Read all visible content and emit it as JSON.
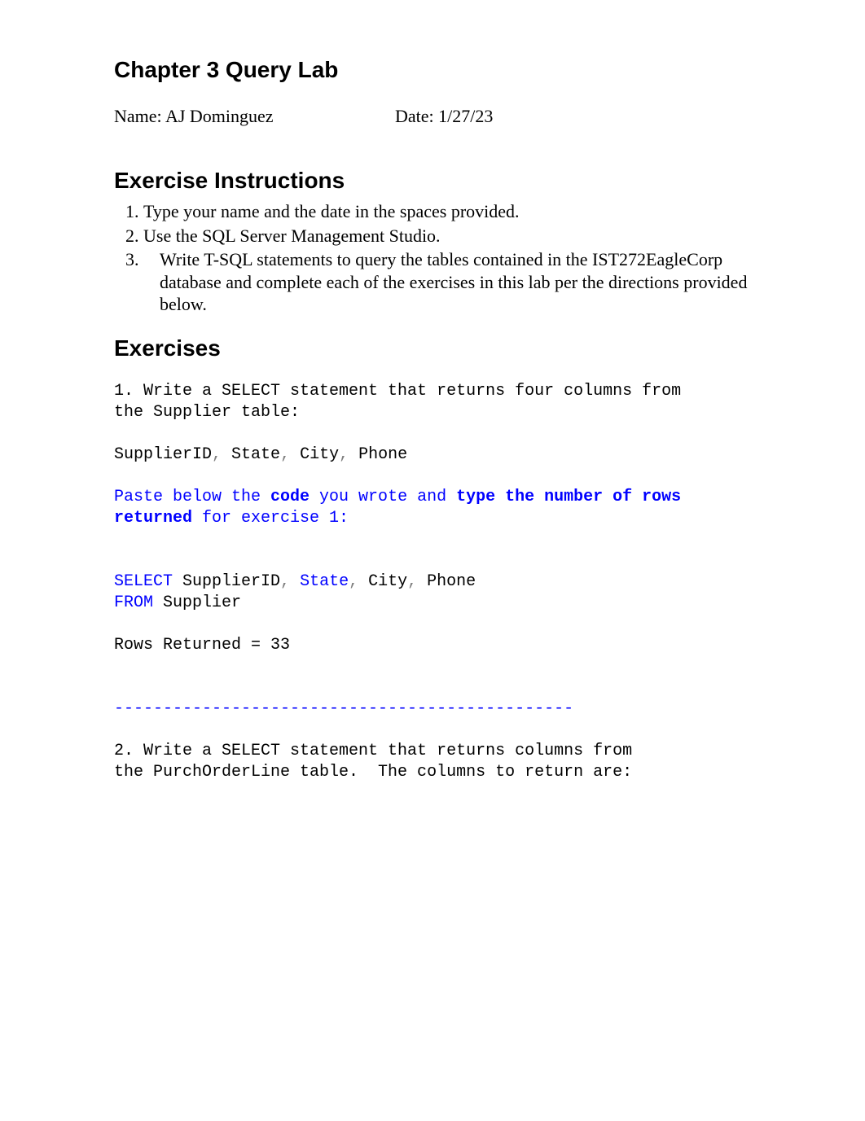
{
  "chapter_title": "Chapter 3 Query Lab",
  "name_label": "Name: ",
  "name_value": "AJ Dominguez",
  "date_label": "Date: ",
  "date_value": "1/27/23",
  "instructions_heading": "Exercise Instructions",
  "instructions": [
    "Type your name and the date in the spaces provided.",
    "Use the SQL Server Management Studio.",
    "Write T-SQL statements to query the tables contained in the IST272EagleCorp database and complete each of the exercises in this lab per the directions provided below."
  ],
  "exercises_heading": "Exercises",
  "ex1_intro_l1": "1. Write a SELECT statement that returns four columns from",
  "ex1_intro_l2": "the Supplier table:",
  "ex1_cols_pre1": "SupplierID",
  "ex1_cols_c1": ",",
  "ex1_cols_pre2": " State",
  "ex1_cols_c2": ",",
  "ex1_cols_pre3": " City",
  "ex1_cols_c3": ",",
  "ex1_cols_post": " Phone",
  "ex1_paste_pre": "Paste below the ",
  "ex1_paste_code": "code",
  "ex1_paste_mid": " you wrote and ",
  "ex1_paste_rows": "type the number of rows returned",
  "ex1_paste_post": " for exercise 1:",
  "ex1_sql_select": "SELECT",
  "ex1_sql_sp1": " SupplierID",
  "ex1_sql_c1": ",",
  "ex1_sql_sp2": " State",
  "ex1_sql_c2": ",",
  "ex1_sql_sp3": " City",
  "ex1_sql_c3": ",",
  "ex1_sql_sp4": " Phone",
  "ex1_sql_from": "FROM",
  "ex1_sql_table": " Supplier",
  "ex1_rows": "Rows Returned = 33",
  "divider": "-----------------------------------------------",
  "ex2_intro_l1": "2. Write a SELECT statement that returns columns from",
  "ex2_intro_l2": "the PurchOrderLine table.  The columns to return are:"
}
